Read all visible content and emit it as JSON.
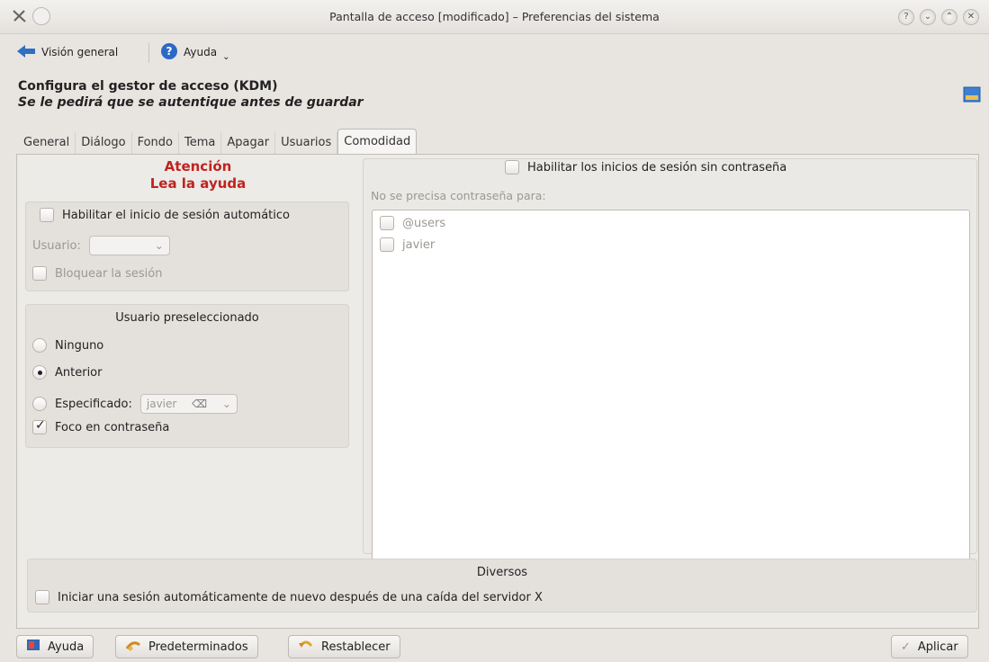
{
  "window": {
    "title": "Pantalla de acceso [modificado] – Preferencias del sistema",
    "buttons": [
      "?",
      "⌄",
      "⌃",
      "✕"
    ]
  },
  "toolbar": {
    "overview": "Visión general",
    "help": "Ayuda"
  },
  "header": {
    "title": "Configura el gestor de acceso (KDM)",
    "subtitle": "Se le pedirá que se autentique antes de guardar"
  },
  "tabs": [
    "General",
    "Diálogo",
    "Fondo",
    "Tema",
    "Apagar",
    "Usuarios",
    "Comodidad"
  ],
  "left": {
    "attention_1": "Atención",
    "attention_2": "Lea la ayuda",
    "autologin_label": "Habilitar el inicio de sesión automático",
    "user_label": "Usuario:",
    "user_value": "",
    "lock_label": "Bloquear la sesión",
    "preselected_title": "Usuario preseleccionado",
    "radio_none": "Ninguno",
    "radio_previous": "Anterior",
    "radio_specified": "Especificado:",
    "specified_value": "javier",
    "focus_password": "Foco en contraseña"
  },
  "right": {
    "passwordless_label": "Habilitar los inicios de sesión sin contraseña",
    "no_password_for": "No se precisa contraseña para:",
    "users": [
      "@users",
      "javier"
    ]
  },
  "misc": {
    "title": "Diversos",
    "restart_label": "Iniciar una sesión automáticamente de nuevo después de una caída del servidor X"
  },
  "footer": {
    "help": "Ayuda",
    "defaults": "Predeterminados",
    "reset": "Restablecer",
    "apply": "Aplicar"
  },
  "state": {
    "autologin": false,
    "lock_session": false,
    "preselected": "Anterior",
    "focus_password": true,
    "passwordless": false,
    "restart_after_crash": false
  }
}
